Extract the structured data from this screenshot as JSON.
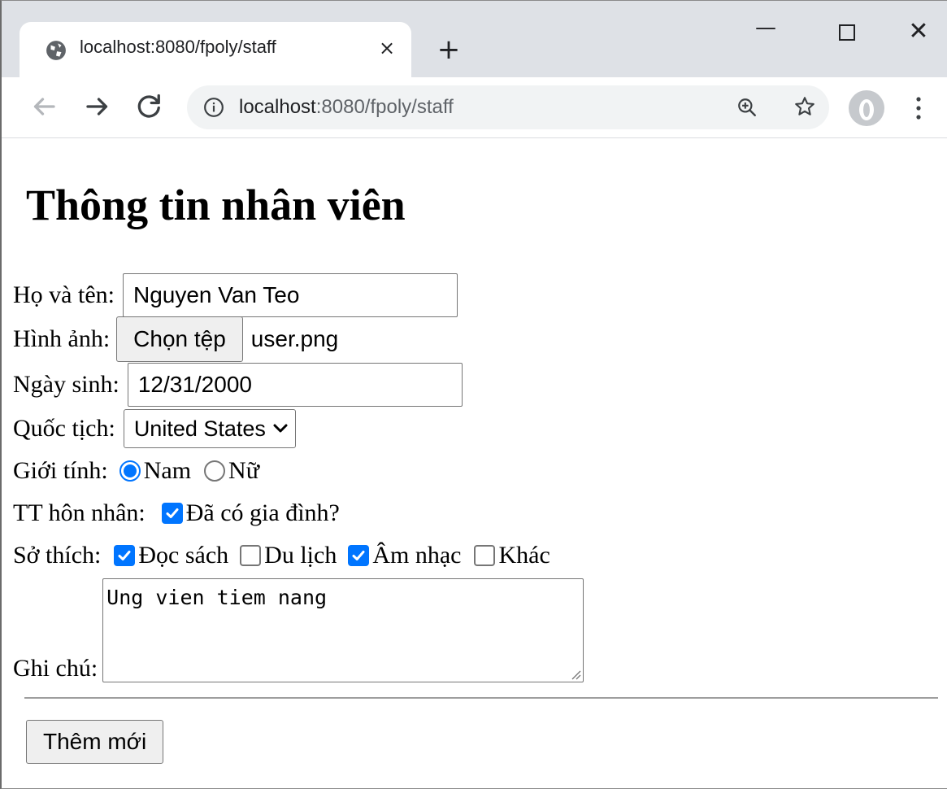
{
  "browser": {
    "tab_title": "localhost:8080/fpoly/staff",
    "url_host": "localhost",
    "url_path": ":8080/fpoly/staff",
    "new_tab_glyph": "+",
    "close_glyph": "×",
    "minimize_glyph": "—",
    "window_close_glyph": "✕"
  },
  "page": {
    "heading": "Thông tin nhân viên",
    "fullname": {
      "label": "Họ và tên:",
      "value": "Nguyen Van Teo"
    },
    "photo": {
      "label": "Hình ảnh:",
      "button": "Chọn tệp",
      "filename": "user.png"
    },
    "birthday": {
      "label": "Ngày sinh:",
      "value": "12/31/2000"
    },
    "country": {
      "label": "Quốc tịch:",
      "selected": "United States"
    },
    "gender": {
      "label": "Giới tính:",
      "options": [
        "Nam",
        "Nữ"
      ],
      "selected": "Nam"
    },
    "marital": {
      "label": "TT hôn nhân:",
      "option": "Đã có gia đình?",
      "checked": true
    },
    "hobbies": {
      "label": "Sở thích:",
      "options": [
        {
          "label": "Đọc sách",
          "checked": true
        },
        {
          "label": "Du lịch",
          "checked": false
        },
        {
          "label": "Âm nhạc",
          "checked": true
        },
        {
          "label": "Khác",
          "checked": false
        }
      ]
    },
    "notes": {
      "label": "Ghi chú:",
      "value": "Ung vien tiem nang"
    },
    "submit": "Thêm mới"
  },
  "colors": {
    "accent": "#0075ff",
    "tabstrip": "#dee1e6",
    "omnibox": "#f1f3f4"
  }
}
